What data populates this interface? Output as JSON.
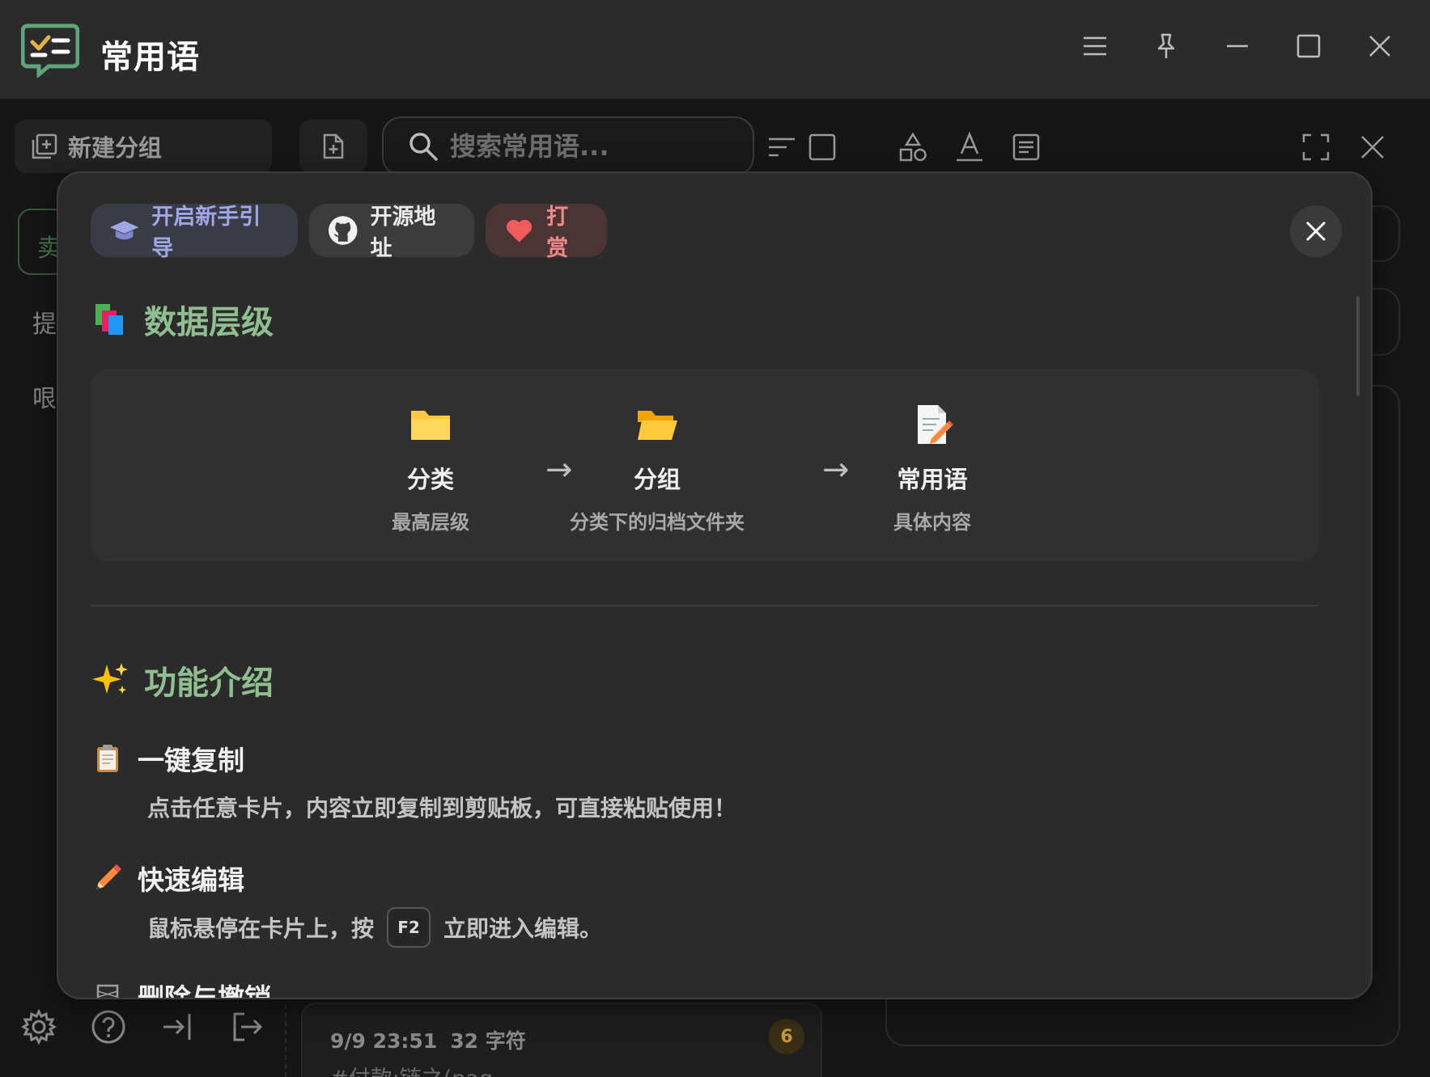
{
  "app": {
    "title": "常用语"
  },
  "toolbar": {
    "new_group_label": "新建分组",
    "search_placeholder": "搜索常用语..."
  },
  "sidebar": {
    "input_partial": "卖",
    "items": [
      "提",
      "哏"
    ]
  },
  "bottom_card": {
    "date": "9/9 23:51",
    "chars": "32 字符",
    "count": "6",
    "snippet": "#付款:链之(pag"
  },
  "modal": {
    "buttons": {
      "guide": "开启新手引导",
      "github": "开源地址",
      "donate": "打赏"
    },
    "hierarchy": {
      "title": "数据层级",
      "items": [
        {
          "name": "分类",
          "desc": "最高层级",
          "icon": "folder-icon"
        },
        {
          "name": "分组",
          "desc": "分类下的归档文件夹",
          "icon": "open-folder-icon"
        },
        {
          "name": "常用语",
          "desc": "具体内容",
          "icon": "memo-icon"
        }
      ],
      "arrow": "→"
    },
    "features": {
      "title": "功能介绍",
      "items": [
        {
          "title": "一键复制",
          "desc": "点击任意卡片，内容立即复制到剪贴板，可直接粘贴使用！",
          "icon": "clipboard-icon"
        },
        {
          "title": "快速编辑",
          "desc_before": "鼠标悬停在卡片上，按",
          "key": "F2",
          "desc_after": "立即进入编辑。",
          "icon": "pencil-icon"
        },
        {
          "title": "删除与撤销",
          "icon": "wastebasket-icon"
        }
      ]
    }
  },
  "colors": {
    "accent_green": "#8fbf8f",
    "guide_blue": "#9fa7e6",
    "donate_red": "#f08a8a"
  }
}
